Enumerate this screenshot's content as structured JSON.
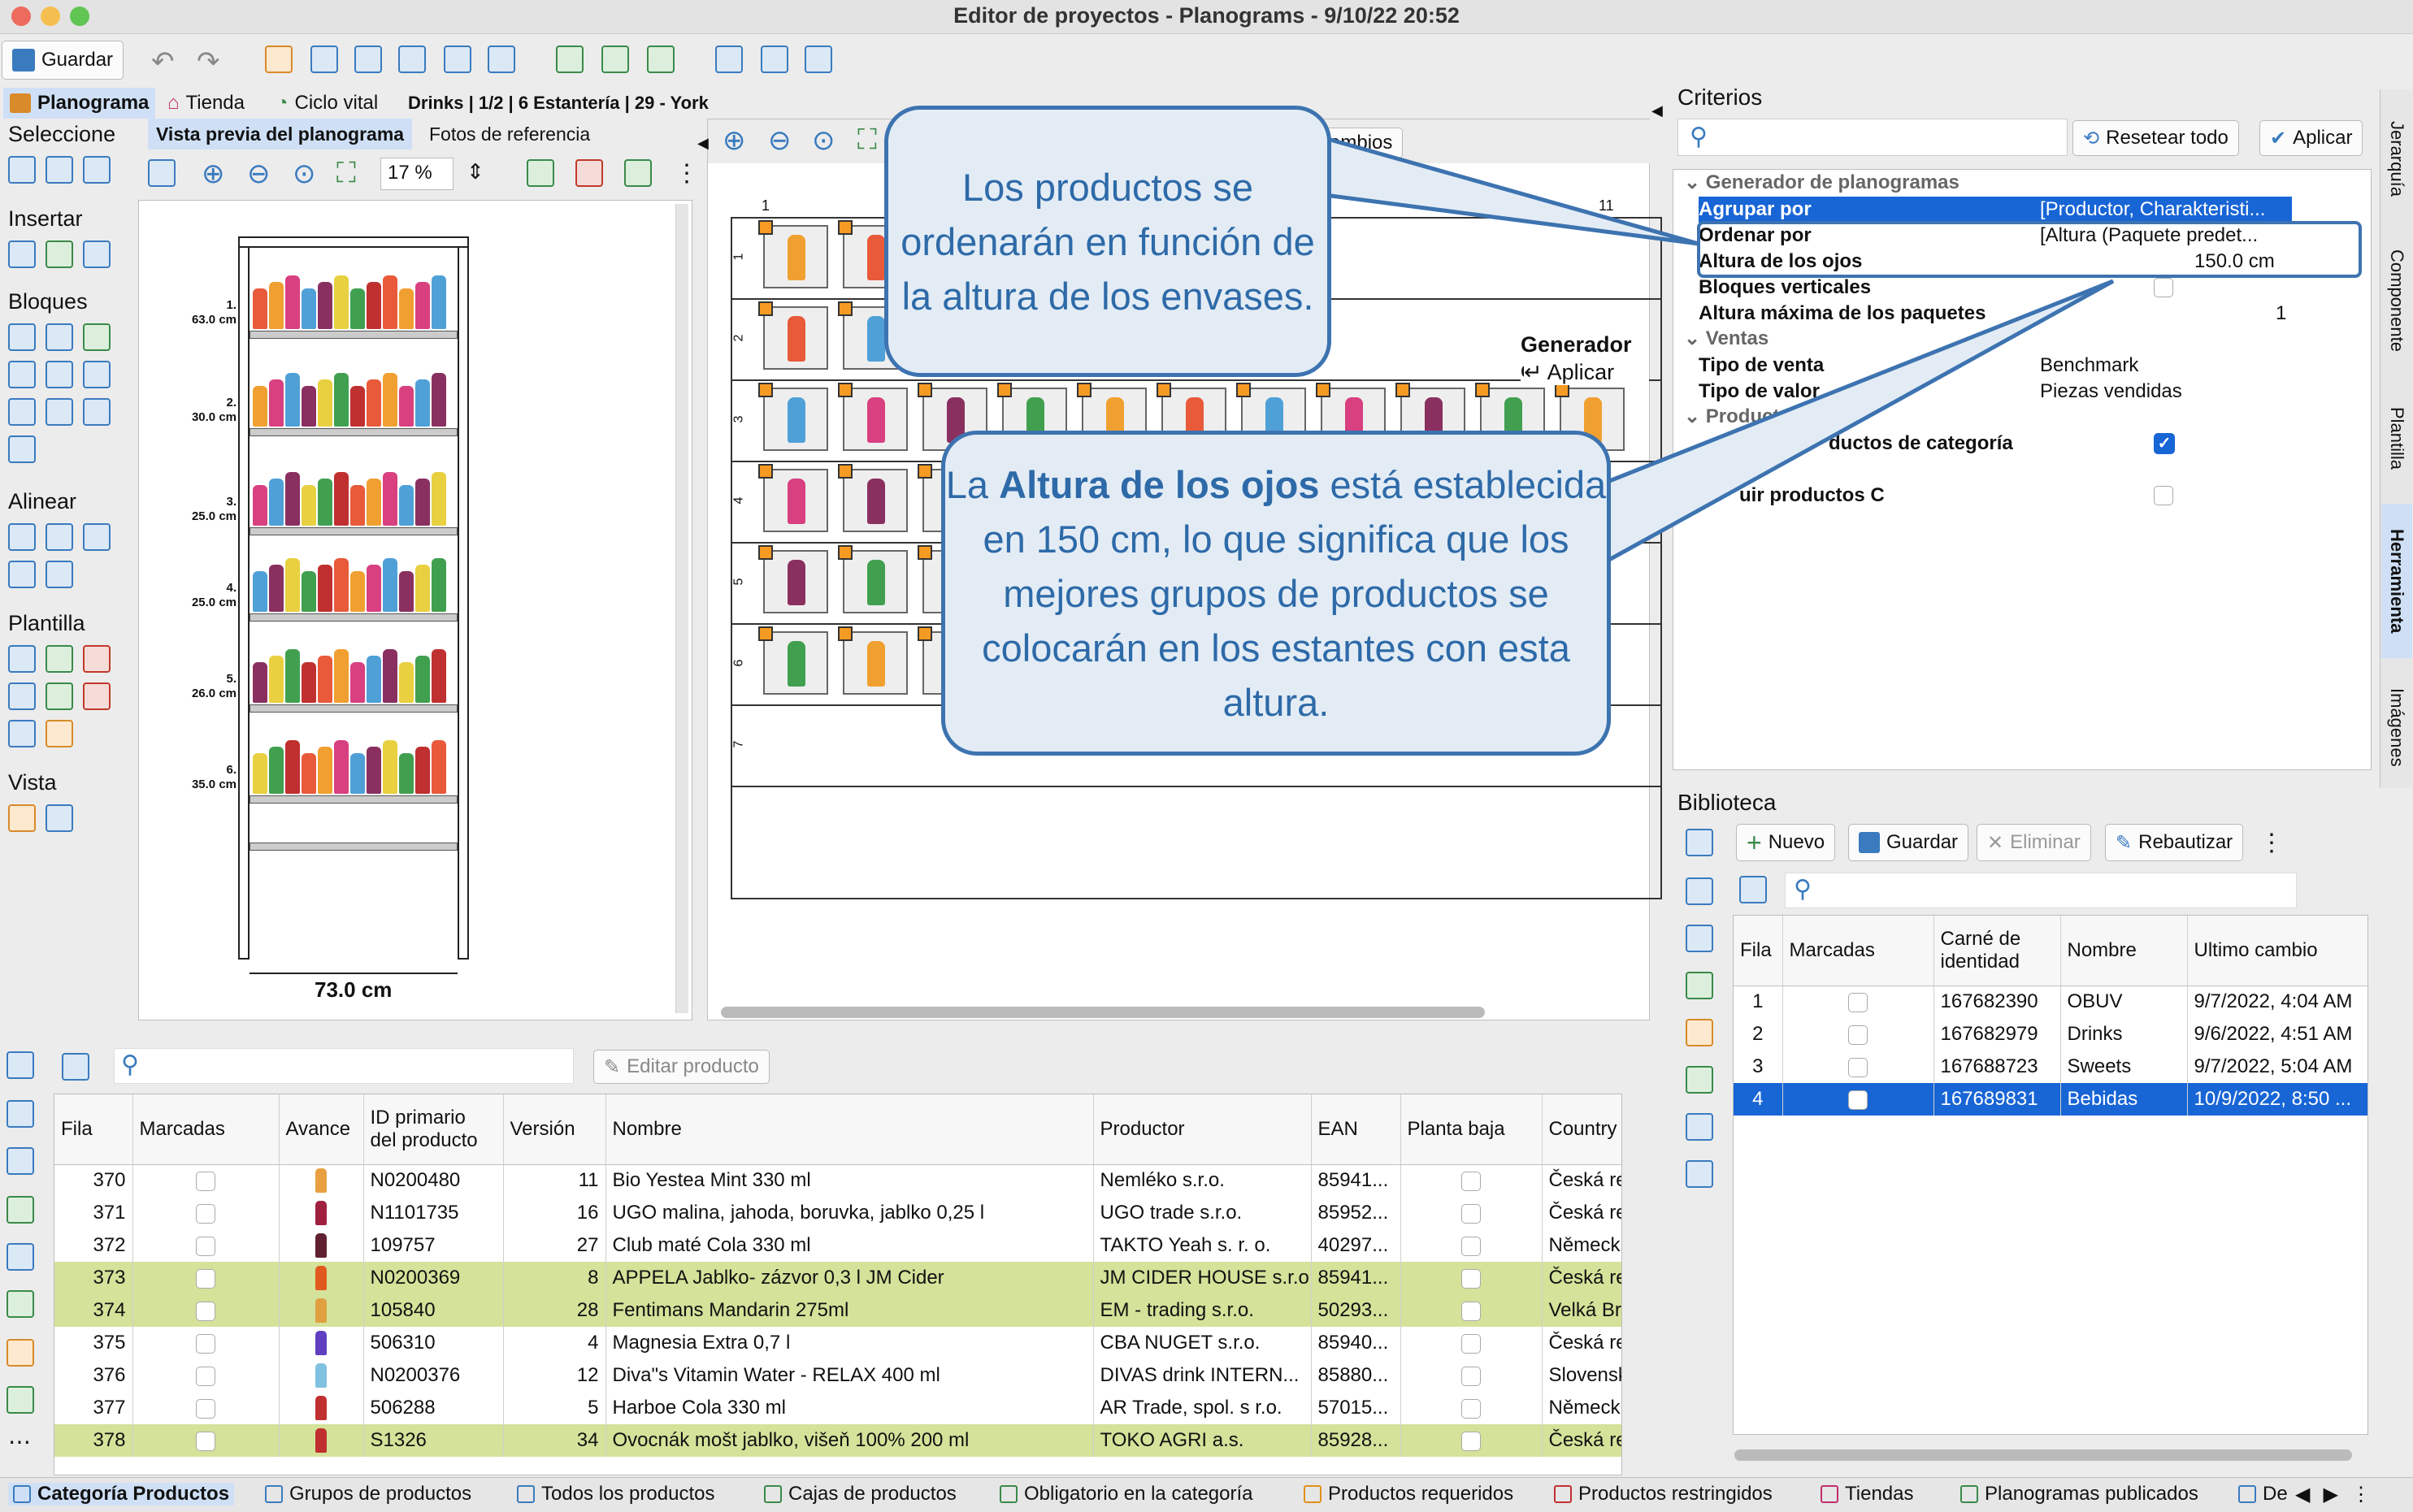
{
  "window": {
    "title": "Editor de proyectos - Planograms - 9/10/22 20:52"
  },
  "toolbar": {
    "save": "Guardar"
  },
  "tabs": {
    "planograma": "Planograma",
    "tienda": "Tienda",
    "ciclo": "Ciclo vital",
    "breadcrumb": "Drinks | 1/2 | 6 Estantería | 29 - York"
  },
  "sidebar": {
    "seleccione": "Seleccione",
    "insertar": "Insertar",
    "bloques": "Bloques",
    "alinear": "Alinear",
    "plantilla": "Plantilla",
    "vista": "Vista"
  },
  "preview": {
    "tab_active": "Vista previa del planograma",
    "tab_photos": "Fotos de referencia",
    "zoom": "17 %",
    "width_label": "73.0 cm",
    "shelves": [
      {
        "num": "1.",
        "h": "63.0 cm"
      },
      {
        "num": "2.",
        "h": "30.0 cm"
      },
      {
        "num": "3.",
        "h": "25.0 cm"
      },
      {
        "num": "4.",
        "h": "25.0 cm"
      },
      {
        "num": "5.",
        "h": "26.0 cm"
      },
      {
        "num": "6.",
        "h": "35.0 cm"
      }
    ]
  },
  "editor": {
    "cambios": "cambios",
    "generador": "Generador d",
    "aplicar": "↵ Aplicar",
    "col_first": "1",
    "col_last": "11",
    "row_nums": [
      "1",
      "2",
      "3",
      "4",
      "5",
      "6",
      "7"
    ]
  },
  "criterios": {
    "title": "Criterios",
    "reset": "Resetear todo",
    "apply": "Aplicar",
    "group_gen": "Generador de planogramas",
    "agrupar": {
      "label": "Agrupar por",
      "value": "[Productor, Charakteristi..."
    },
    "ordenar": {
      "label": "Ordenar por",
      "value": "[Altura (Paquete predet..."
    },
    "altura": {
      "label": "Altura de los ojos",
      "value": "150.0 cm"
    },
    "bloques": {
      "label": "Bloques verticales"
    },
    "altmax": {
      "label": "Altura máxima de los paquetes",
      "value": "1"
    },
    "group_ventas": "Ventas",
    "tipo_venta": {
      "label": "Tipo de venta",
      "value": "Benchmark"
    },
    "tipo_valor": {
      "label": "Tipo de valor",
      "value": "Piezas vendidas"
    },
    "group_product": "Product",
    "prod_cat": "ductos de categoría",
    "prod_c": "uir productos C",
    "group_s": "s"
  },
  "biblioteca": {
    "title": "Biblioteca",
    "new": "Nuevo",
    "save": "Guardar",
    "delete": "Eliminar",
    "rename": "Rebautizar",
    "cols": [
      "Fila",
      "Marcadas",
      "Carné de identidad",
      "Nombre",
      "Ultimo cambio"
    ],
    "rows": [
      {
        "fila": "1",
        "id": "167682390",
        "nombre": "OBUV",
        "cambio": "9/7/2022, 4:04 AM"
      },
      {
        "fila": "2",
        "id": "167682979",
        "nombre": "Drinks",
        "cambio": "9/6/2022, 4:51 AM"
      },
      {
        "fila": "3",
        "id": "167688723",
        "nombre": "Sweets",
        "cambio": "9/7/2022, 5:04 AM"
      },
      {
        "fila": "4",
        "id": "167689831",
        "nombre": "Bebidas",
        "cambio": "10/9/2022, 8:50 ..."
      }
    ]
  },
  "products": {
    "edit": "Editar producto",
    "cols": [
      "Fila",
      "Marcadas",
      "Avance",
      "ID primario del producto",
      "Versión",
      "Nombre",
      "Productor",
      "EAN",
      "Planta baja",
      "Country"
    ],
    "rows": [
      {
        "fila": "370",
        "id": "N0200480",
        "ver": "11",
        "nombre": "Bio Yestea Mint 330 ml",
        "prod": "Nemléko s.r.o.",
        "ean": "85941...",
        "country": "Česká re"
      },
      {
        "fila": "371",
        "id": "N1101735",
        "ver": "16",
        "nombre": "UGO malina, jahoda, boruvka, jablko 0,25 l",
        "prod": "UGO trade s.r.o.",
        "ean": "85952...",
        "country": "Česká re"
      },
      {
        "fila": "372",
        "id": "109757",
        "ver": "27",
        "nombre": "Club maté Cola 330 ml",
        "prod": "TAKTO Yeah s. r. o.",
        "ean": "40297...",
        "country": "Německ"
      },
      {
        "fila": "373",
        "id": "N0200369",
        "ver": "8",
        "nombre": "APPELA Jablko- zázvor 0,3 l JM Cider",
        "prod": "JM CIDER HOUSE s.r.o.",
        "ean": "85941...",
        "country": "Česká re"
      },
      {
        "fila": "374",
        "id": "105840",
        "ver": "28",
        "nombre": "Fentimans Mandarin 275ml",
        "prod": "EM - trading s.r.o.",
        "ean": "50293...",
        "country": "Velká Br"
      },
      {
        "fila": "375",
        "id": "506310",
        "ver": "4",
        "nombre": "Magnesia Extra 0,7 l",
        "prod": "CBA NUGET s.r.o.",
        "ean": "85940...",
        "country": "Česká re"
      },
      {
        "fila": "376",
        "id": "N0200376",
        "ver": "12",
        "nombre": "Diva\"s Vitamin Water - RELAX 400 ml",
        "prod": "DIVAS drink INTERN...",
        "ean": "85880...",
        "country": "Slovensk"
      },
      {
        "fila": "377",
        "id": "506288",
        "ver": "5",
        "nombre": "Harboe Cola 330 ml",
        "prod": "AR Trade, spol. s r.o.",
        "ean": "57015...",
        "country": "Německ"
      },
      {
        "fila": "378",
        "id": "S1326",
        "ver": "34",
        "nombre": "Ovocnák mošt jablko, višeň 100% 200 ml",
        "prod": "TOKO AGRI a.s.",
        "ean": "85928...",
        "country": "Česká re"
      }
    ]
  },
  "bottom_tabs": [
    "Categoría Productos",
    "Grupos de productos",
    "Todos los productos",
    "Cajas de productos",
    "Obligatorio en la categoría",
    "Productos requeridos",
    "Productos restringidos",
    "Tiendas",
    "Planogramas publicados",
    "De"
  ],
  "side_tabs": [
    "Jerarquía",
    "Componente",
    "Plantilla",
    "Herramienta",
    "Imágenes"
  ],
  "callouts": {
    "top": "Los productos se ordenarán en función de la altura de los envases.",
    "bottom_pre": "La ",
    "bottom_bold": "Altura de los ojos",
    "bottom_post": " está establecida en 150 cm, lo que significa que los mejores grupos de productos se colocarán en los estantes con esta altura."
  }
}
